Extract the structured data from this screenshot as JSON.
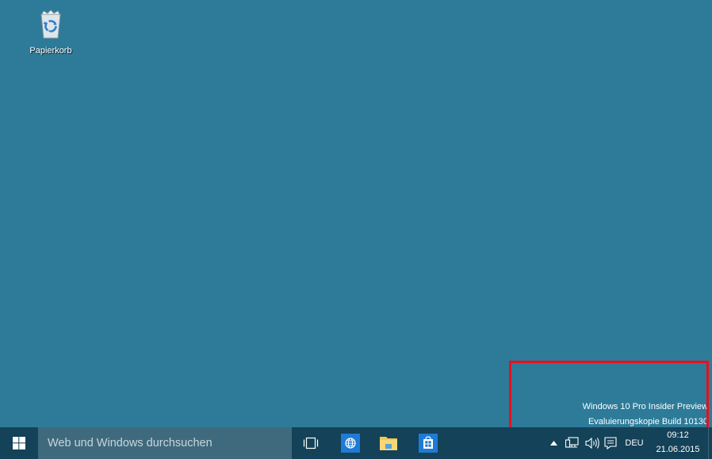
{
  "desktop": {
    "icons": [
      {
        "label": "Papierkorb",
        "icon": "recycle-bin-icon"
      }
    ],
    "watermark": {
      "line1": "Windows 10 Pro Insider Preview",
      "line2": "Evaluierungskopie Build 10130"
    },
    "highlight_color": "#e8101c",
    "background_color": "#2d7b99"
  },
  "taskbar": {
    "background_color": "#144258",
    "start_icon": "windows-logo-icon",
    "search": {
      "placeholder": "Web und Windows durchsuchen"
    },
    "pinned": [
      {
        "name": "task-view",
        "icon": "task-view-icon"
      },
      {
        "name": "edge",
        "icon": "globe-icon"
      },
      {
        "name": "file-explorer",
        "icon": "folder-icon"
      },
      {
        "name": "store",
        "icon": "store-bag-icon"
      }
    ],
    "tray": {
      "icons": [
        "chevron-up-icon",
        "network-icon",
        "speaker-icon",
        "notification-icon"
      ],
      "language": "DEU",
      "time": "09:12",
      "date": "21.06.2015"
    }
  }
}
